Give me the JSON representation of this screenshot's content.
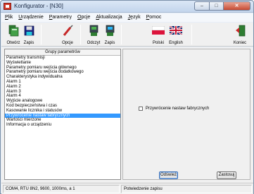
{
  "window": {
    "title": "Konfigurator - [N30]"
  },
  "menu": [
    {
      "label": "Plik",
      "accel": "P",
      "rest": "lik"
    },
    {
      "label": "Urządzenie",
      "accel": "U",
      "rest": "rządzenie"
    },
    {
      "label": "Parametry",
      "accel": "P",
      "rest": "arametry"
    },
    {
      "label": "Opcje",
      "accel": "O",
      "rest": "pcje"
    },
    {
      "label": "Aktualizacja",
      "accel": "A",
      "rest": "ktualizacja"
    },
    {
      "label": "Język",
      "accel": "J",
      "rest": "ęzyk"
    },
    {
      "label": "Pomoc",
      "accel": "P",
      "rest": "omoc"
    }
  ],
  "toolbar": {
    "open": "Otwórz",
    "save": "Zapis",
    "options": "Opcje",
    "read": "Odczyt",
    "write": "Zapis",
    "polish": "Polski",
    "english": "English",
    "exit": "Koniec"
  },
  "left_panel": {
    "header": "Grupy parametrów",
    "items": [
      "Parametry transmisji",
      "Wyświetlanie",
      "Parametry pomiaru wejścia głównego",
      "Parametry pomiaru wejścia dodatkowego",
      "Charakterystyka indywidualna",
      "Alarm 1",
      "Alarm 2",
      "Alarm 3",
      "Alarm 4",
      "Wyjście analogowe",
      "Kod bezpieczeństwa i czas",
      "Kasowanie licznika i statusów",
      "Przywrócenie nastaw fabrycznych",
      "Wartości mierzone",
      "Informacja o urządzeniu"
    ],
    "selected_index": 12
  },
  "right_panel": {
    "checkbox_label": "Przywrócenie nastaw fabrycznych",
    "checkbox_checked": false,
    "refresh_button": "Odśwież",
    "apply_button": "Zastosuj"
  },
  "status": {
    "connection": "COM4, RTU 8N2, 9600, 1000ms, a 1",
    "message": "Potwiedzenie zapisu"
  },
  "colors": {
    "selection": "#3399ff",
    "close_button": "#c74a32"
  }
}
